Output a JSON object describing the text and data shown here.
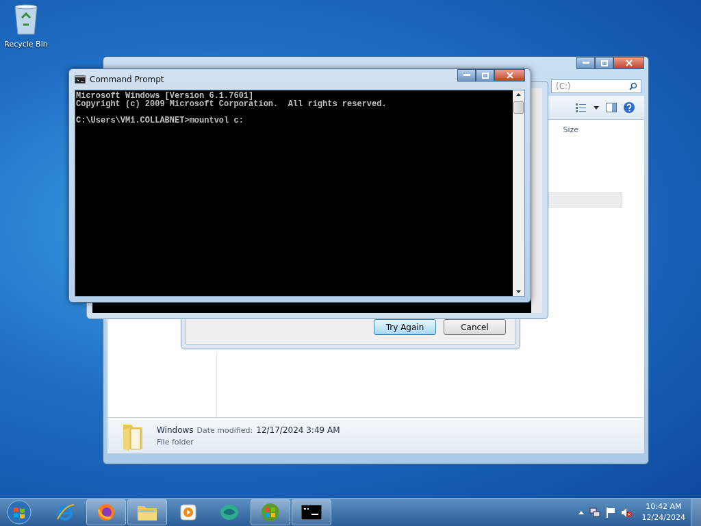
{
  "desktop_icons": [
    {
      "label": "Recycle Bin"
    }
  ],
  "explorer": {
    "search": {
      "placeholder": "(C:)"
    },
    "columns": [
      "Size"
    ],
    "details": {
      "name": "Windows",
      "date_label": "Date modified:",
      "date": "12/17/2024 3:49 AM",
      "type": "File folder"
    }
  },
  "dialog": {
    "buttons": [
      {
        "label": "Try Again",
        "focused": true
      },
      {
        "label": "Cancel",
        "focused": false
      }
    ]
  },
  "command_prompt": {
    "title": "Command Prompt",
    "banner": [
      "Microsoft Windows [Version 6.1.7601]",
      "Copyright (c) 2009 Microsoft Corporation.  All rights reserved."
    ],
    "prompt": "C:\\Users\\VM1.COLLABNET>mountvol c:"
  },
  "taskbar": {
    "items": [
      {
        "kind": "ie",
        "running": false
      },
      {
        "kind": "firefox",
        "running": true
      },
      {
        "kind": "explorer",
        "running": true
      },
      {
        "kind": "media",
        "running": false
      },
      {
        "kind": "app",
        "running": false
      },
      {
        "kind": "winlogo",
        "running": true
      },
      {
        "kind": "cmd",
        "running": true
      }
    ],
    "clock": {
      "time": "10:42 AM",
      "date": "12/24/2024"
    }
  }
}
